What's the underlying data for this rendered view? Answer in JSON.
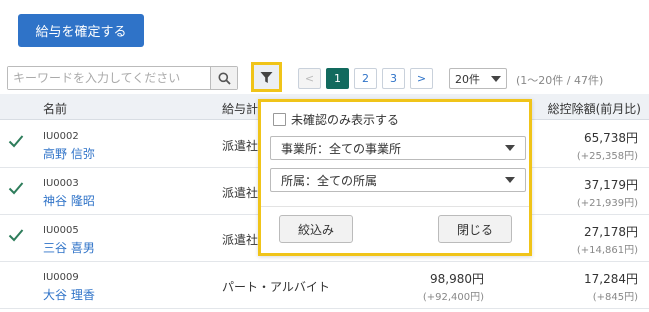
{
  "toolbar": {
    "confirm_label": "給与を確定する"
  },
  "search": {
    "placeholder": "キーワードを入力してください",
    "value": ""
  },
  "icons": {
    "search": "search-icon",
    "filter": "filter-icon",
    "check": "check-icon",
    "dropdown": "triangle-down-icon"
  },
  "colors": {
    "primary": "#2f73c8",
    "highlight": "#f0c419",
    "active_page": "#126a5e",
    "check": "#2e7d5b"
  },
  "pagination": {
    "prev": "<",
    "next": ">",
    "pages": [
      "1",
      "2",
      "3"
    ],
    "current": "1",
    "per_page": "20件",
    "range_text": "(1〜20件 / 47件)"
  },
  "table": {
    "headers": {
      "name": "名前",
      "type": "給与計",
      "deduction": "総控除額(前月比)"
    },
    "rows": [
      {
        "checked": true,
        "code": "IU0002",
        "name": "高野 信弥",
        "type": "派遣社",
        "amount": "",
        "amount_diff": "",
        "deduction": "65,738円",
        "deduction_diff": "(+25,358円)"
      },
      {
        "checked": true,
        "code": "IU0003",
        "name": "神谷 隆昭",
        "type": "派遣社",
        "amount": "",
        "amount_diff": "",
        "deduction": "37,179円",
        "deduction_diff": "(+21,939円)"
      },
      {
        "checked": true,
        "code": "IU0005",
        "name": "三谷 喜男",
        "type": "派遣社",
        "amount": "",
        "amount_diff": "",
        "deduction": "27,178円",
        "deduction_diff": "(+14,861円)"
      },
      {
        "checked": false,
        "code": "IU0009",
        "name": "大谷 理香",
        "type": "パート・アルバイト",
        "amount": "98,980円",
        "amount_diff": "(+92,400円)",
        "deduction": "17,284円",
        "deduction_diff": "(+845円)"
      }
    ]
  },
  "filter_popup": {
    "unconfirmed_label": "未確認のみ表示する",
    "unconfirmed_checked": false,
    "office_select": "事業所：全ての事業所",
    "dept_select": "所属：全ての所属",
    "apply_label": "絞込み",
    "close_label": "閉じる"
  }
}
